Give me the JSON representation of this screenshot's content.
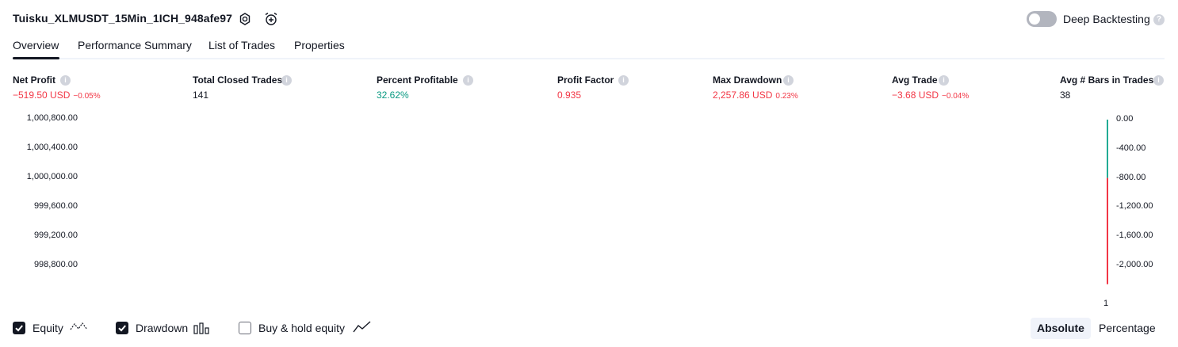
{
  "header": {
    "strategy_title": "Tuisku_XLMUSDT_15Min_1ICH_948afe97",
    "settings_icon": "gear-icon",
    "alert_icon": "add-alert-icon",
    "deep_backtesting": {
      "label": "Deep Backtesting",
      "enabled": false,
      "help": "?"
    }
  },
  "tabs": [
    {
      "label": "Overview",
      "active": true
    },
    {
      "label": "Performance Summary",
      "active": false
    },
    {
      "label": "List of Trades",
      "active": false
    },
    {
      "label": "Properties",
      "active": false
    }
  ],
  "metrics": [
    {
      "label": "Net Profit",
      "value": "−519.50 USD",
      "pct": "−0.05%",
      "color": "#f23645"
    },
    {
      "label": "Total Closed Trades",
      "value": "141",
      "pct": "",
      "color": "#131722"
    },
    {
      "label": "Percent Profitable",
      "value": "32.62%",
      "pct": "",
      "color": "#089981"
    },
    {
      "label": "Profit Factor",
      "value": "0.935",
      "pct": "",
      "color": "#f23645"
    },
    {
      "label": "Max Drawdown",
      "value": "2,257.86 USD",
      "pct": "0.23%",
      "color": "#f23645"
    },
    {
      "label": "Avg Trade",
      "value": "−3.68 USD",
      "pct": "−0.04%",
      "color": "#f23645"
    },
    {
      "label": "Avg # Bars in Trades",
      "value": "38",
      "pct": "",
      "color": "#131722"
    }
  ],
  "info_glyph": "i",
  "chart_data": {
    "type": "line",
    "left_axis_ticks": [
      "1,000,800.00",
      "1,000,400.00",
      "1,000,000.00",
      "999,600.00",
      "999,200.00",
      "998,800.00"
    ],
    "right_axis_ticks": [
      "0.00",
      "-400.00",
      "-800.00",
      "-1,200.00",
      "-1,600.00",
      "-2,000.00"
    ],
    "x_ticks": [
      "1"
    ],
    "left_ylim": [
      998800,
      1000800
    ],
    "right_ylim": [
      -2000,
      0
    ],
    "series": [
      {
        "values": [
          0,
          -800
        ],
        "color": "#22ab94"
      },
      {
        "values": [
          -800,
          -2257.86
        ],
        "color": "#f23645"
      }
    ]
  },
  "legend": [
    {
      "label": "Equity",
      "checked": true,
      "icon": "equity-line-icon"
    },
    {
      "label": "Drawdown",
      "checked": true,
      "icon": "drawdown-bars-icon"
    },
    {
      "label": "Buy & hold equity",
      "checked": false,
      "icon": "buy-hold-line-icon"
    }
  ],
  "scale_modes": [
    {
      "label": "Absolute",
      "active": true
    },
    {
      "label": "Percentage",
      "active": false
    }
  ],
  "colors": {
    "negative": "#f23645",
    "positive": "#089981",
    "text": "#131722"
  }
}
